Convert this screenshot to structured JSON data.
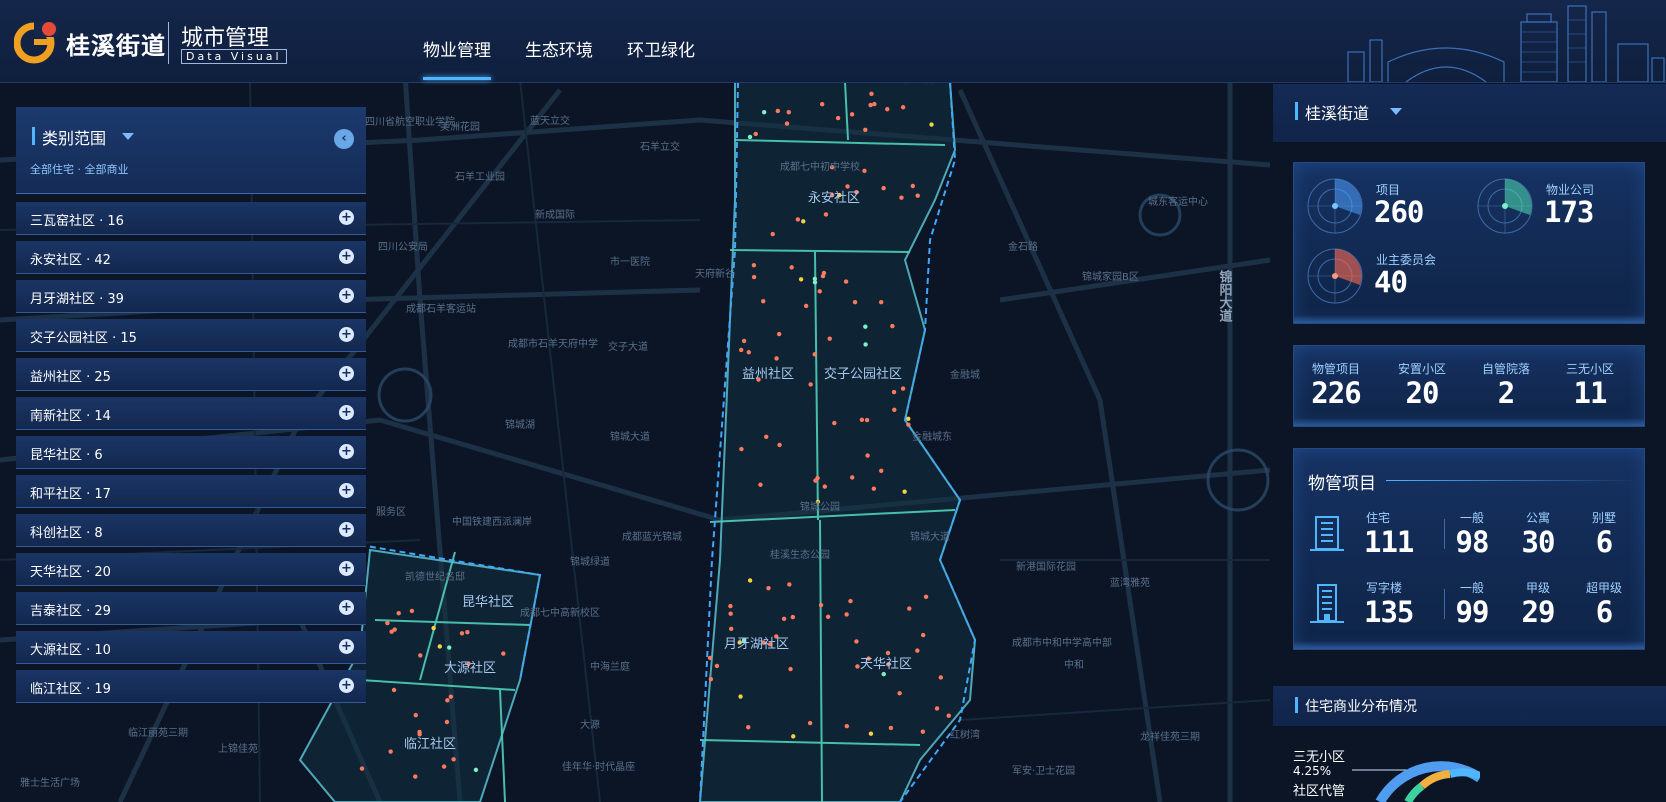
{
  "header": {
    "logo_text": "桂溪街道",
    "title": "城市管理",
    "subtitle": "Data Visual",
    "nav": [
      {
        "label": "物业管理",
        "active": true
      },
      {
        "label": "生态环境",
        "active": false
      },
      {
        "label": "环卫绿化",
        "active": false
      }
    ]
  },
  "left_panel": {
    "title": "类别范围",
    "filter_text": "全部住宅 · 全部商业",
    "items": [
      "三瓦窑社区 · 16",
      "永安社区 · 42",
      "月牙湖社区 · 39",
      "交子公园社区 · 15",
      "益州社区 · 25",
      "南新社区 · 14",
      "昆华社区 · 6",
      "和平社区 · 17",
      "科创社区 · 8",
      "天华社区 · 20",
      "吉泰社区 · 29",
      "大源社区 · 10",
      "临江社区 · 19"
    ]
  },
  "right_panel": {
    "title": "桂溪街道",
    "summary": {
      "project_label": "项目",
      "project_value": "260",
      "company_label": "物业公司",
      "company_value": "173",
      "committee_label": "业主委员会",
      "committee_value": "40"
    },
    "categories": [
      {
        "label": "物管项目",
        "value": "226"
      },
      {
        "label": "安置小区",
        "value": "20"
      },
      {
        "label": "自管院落",
        "value": "2"
      },
      {
        "label": "三无小区",
        "value": "11"
      }
    ],
    "property": {
      "title": "物管项目",
      "residential": {
        "label": "住宅",
        "value": "111",
        "subs": [
          {
            "label": "一般",
            "value": "98"
          },
          {
            "label": "公寓",
            "value": "30"
          },
          {
            "label": "别墅",
            "value": "6"
          }
        ]
      },
      "office": {
        "label": "写字楼",
        "value": "135",
        "subs": [
          {
            "label": "一般",
            "value": "99"
          },
          {
            "label": "甲级",
            "value": "29"
          },
          {
            "label": "超甲级",
            "value": "6"
          }
        ]
      }
    },
    "distribution": {
      "title": "住宅商业分布情况",
      "label1": "三无小区",
      "pct1": "4.25%",
      "label2": "社区代管"
    }
  },
  "map": {
    "communities": [
      "永安社区",
      "益州社区",
      "交子公园社区",
      "月牙湖社区",
      "天华社区",
      "昆华社区",
      "大源社区",
      "临江社区",
      "三瓦窑社区"
    ],
    "places": [
      "四川省航空职业学院",
      "美洲花园",
      "蓝天立交",
      "石羊立交",
      "石羊工业园",
      "成都七中初中学校",
      "城东客运中心",
      "新成国际",
      "四川公安局",
      "市一医院",
      "天府新谷",
      "金石路",
      "锦城家园B区",
      "成都石羊客运站",
      "成都市石羊天府中学",
      "交子大道",
      "金融城",
      "金融城东",
      "锦城湖",
      "锦城大道",
      "锦城公园",
      "服务区",
      "中国铁建西派澜岸",
      "成都蓝光锦城",
      "锦城绿道",
      "桂溪生态公园",
      "新港国际花园",
      "蓝湾雅苑",
      "凯德世纪名邸",
      "成都七中高新校区",
      "中海兰庭",
      "成都市中和中学高中部",
      "中和",
      "红树湾",
      "大源",
      "临江丽苑三期",
      "上锦佳苑",
      "雅士生活广场",
      "佳年华·时代晶座",
      "龙祥佳苑三期",
      "军安·卫士花园",
      "锦城大道",
      "锦阳大道"
    ]
  }
}
